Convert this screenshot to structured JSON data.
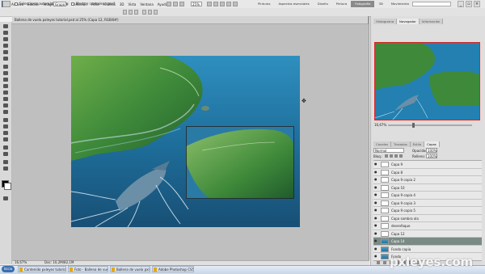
{
  "app": {
    "logo": "Ps",
    "menus": [
      "Archivo",
      "Edición",
      "Imagen",
      "Capa",
      "Selección",
      "Filtro",
      "Análisis",
      "3D",
      "Vista",
      "Ventana",
      "Ayuda"
    ],
    "zoom": "25%",
    "workspaces": [
      "Pinturas",
      "Aspectos esenciales",
      "Diseño",
      "Pintura",
      "Fotografía",
      "3D",
      "Movimiento",
      "Novedades de CS 5"
    ],
    "active_workspace": "Fotografía"
  },
  "options": {
    "auto_select_label": "Seleccionar automáticamente:",
    "auto_select_target": "Grupo",
    "show_transform_label": "Mostrar controles transf."
  },
  "document": {
    "tab_title": "Ballena de vuelo pxleyes tutorial.psd al 25% (Capa 12, RGB/8#)",
    "zoom_status": "16,67%",
    "doc_status": "Doc: 10,2M/82,1M"
  },
  "navigator": {
    "tabs": [
      "Histograma",
      "Navegador",
      "Información"
    ],
    "active_tab": "Navegador",
    "zoom": "16,67%"
  },
  "layers": {
    "tabs": [
      "Canales",
      "Trazados",
      "Estilo",
      "Capas"
    ],
    "active_tab": "Capas",
    "blend_mode": "Normal",
    "opacity_label": "Opacidad:",
    "opacity": "100%",
    "lock_label": "Bloq.:",
    "fill_label": "Relleno:",
    "fill": "100%",
    "items": [
      {
        "name": "Capa 9",
        "selected": false,
        "photo": false
      },
      {
        "name": "Capa 8",
        "selected": false,
        "photo": false
      },
      {
        "name": "Capa 9 copia 2",
        "selected": false,
        "photo": false
      },
      {
        "name": "Capa 10",
        "selected": false,
        "photo": false
      },
      {
        "name": "Capa 9 copia 4",
        "selected": false,
        "photo": false
      },
      {
        "name": "Capa 9 copia 3",
        "selected": false,
        "photo": false
      },
      {
        "name": "Capa 9 copia 5",
        "selected": false,
        "photo": false
      },
      {
        "name": "Capa sombra ola",
        "selected": false,
        "photo": false
      },
      {
        "name": "desenfoque",
        "selected": false,
        "photo": false
      },
      {
        "name": "Capa 12",
        "selected": false,
        "photo": false
      },
      {
        "name": "Capa 14",
        "selected": true,
        "photo": true
      },
      {
        "name": "Fondo copia",
        "selected": false,
        "photo": true
      },
      {
        "name": "Fondo",
        "selected": false,
        "photo": true
      }
    ]
  },
  "taskbar": {
    "start": "Inicio",
    "items": [
      "Contenido pxleyes tutorial",
      "Foto - Ballena de vuelo",
      "Ballena de vuelo pxl...",
      "Adobe Photoshop CS5"
    ]
  },
  "watermark": "pxleyes.com",
  "colors": {
    "accent": "#7a8a84",
    "sea": "#1f6d96",
    "land": "#3f8a3a"
  }
}
